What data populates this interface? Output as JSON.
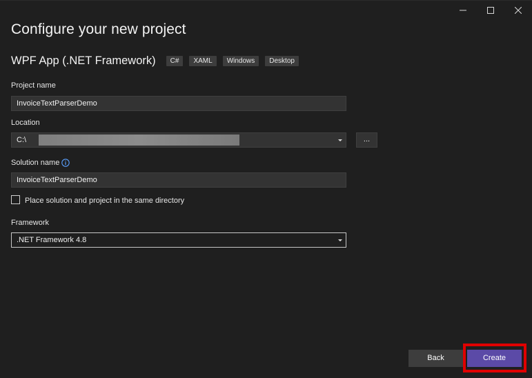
{
  "window": {
    "caption_buttons": [
      "minimize-icon",
      "maximize-icon",
      "close-icon"
    ]
  },
  "page": {
    "title": "Configure your new project"
  },
  "template": {
    "name": "WPF App (.NET Framework)",
    "tags": [
      "C#",
      "XAML",
      "Windows",
      "Desktop"
    ]
  },
  "project_name": {
    "label": "Project name",
    "value": "InvoiceTextParserDemo"
  },
  "location": {
    "label": "Location",
    "value": "C:\\",
    "browse_label": "..."
  },
  "solution_name": {
    "label": "Solution name",
    "value": "InvoiceTextParserDemo",
    "info_icon": "info-icon"
  },
  "same_directory": {
    "label": "Place solution and project in the same directory",
    "checked": false
  },
  "framework": {
    "label": "Framework",
    "selected": ".NET Framework 4.8"
  },
  "footer": {
    "back_label": "Back",
    "create_label": "Create"
  },
  "colors": {
    "background": "#1f1f1f",
    "accent": "#5b4aa7",
    "highlight": "#e00000"
  }
}
